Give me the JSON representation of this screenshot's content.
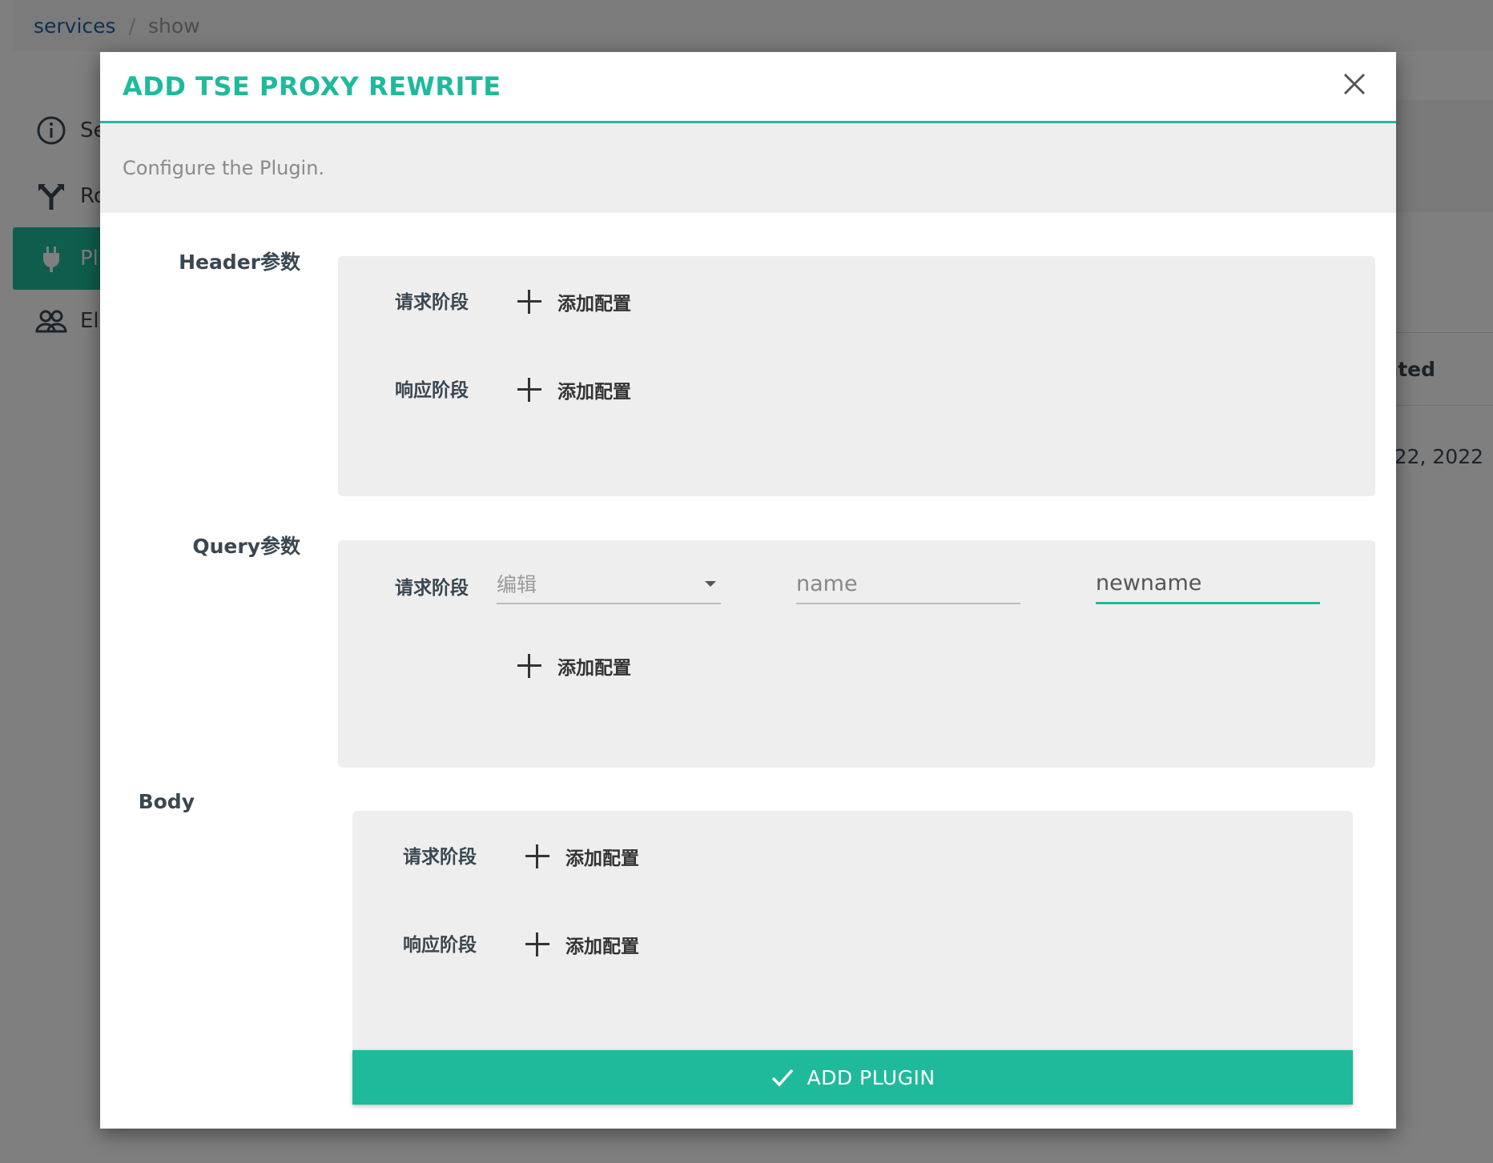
{
  "breadcrumb": {
    "items": [
      "services",
      "show"
    ]
  },
  "sidebar": {
    "items": [
      {
        "label": "Se",
        "icon": "info-icon"
      },
      {
        "label": "Ro",
        "icon": "route-fork-icon"
      },
      {
        "label": "Pl",
        "icon": "plug-icon",
        "active": true
      },
      {
        "label": "Eli",
        "icon": "users-icon"
      }
    ]
  },
  "background": {
    "table_header_fragment": "ated",
    "table_cell_fragment": "22, 2022"
  },
  "modal": {
    "title": "ADD TSE PROXY REWRITE",
    "description": "Configure the Plugin.",
    "sections": {
      "header": {
        "label": "Header参数",
        "request_label": "请求阶段",
        "response_label": "响应阶段",
        "add_label": "添加配置"
      },
      "query": {
        "label": "Query参数",
        "request_label": "请求阶段",
        "select_value": "编辑",
        "name_placeholder": "name",
        "newname_value": "newname",
        "add_label": "添加配置"
      },
      "body": {
        "label": "Body",
        "request_label": "请求阶段",
        "response_label": "响应阶段",
        "add_label": "添加配置"
      }
    },
    "submit_label": "ADD PLUGIN"
  },
  "colors": {
    "accent": "#1fba9b",
    "section_bg": "#eeeeee",
    "text": "#3a4750"
  }
}
